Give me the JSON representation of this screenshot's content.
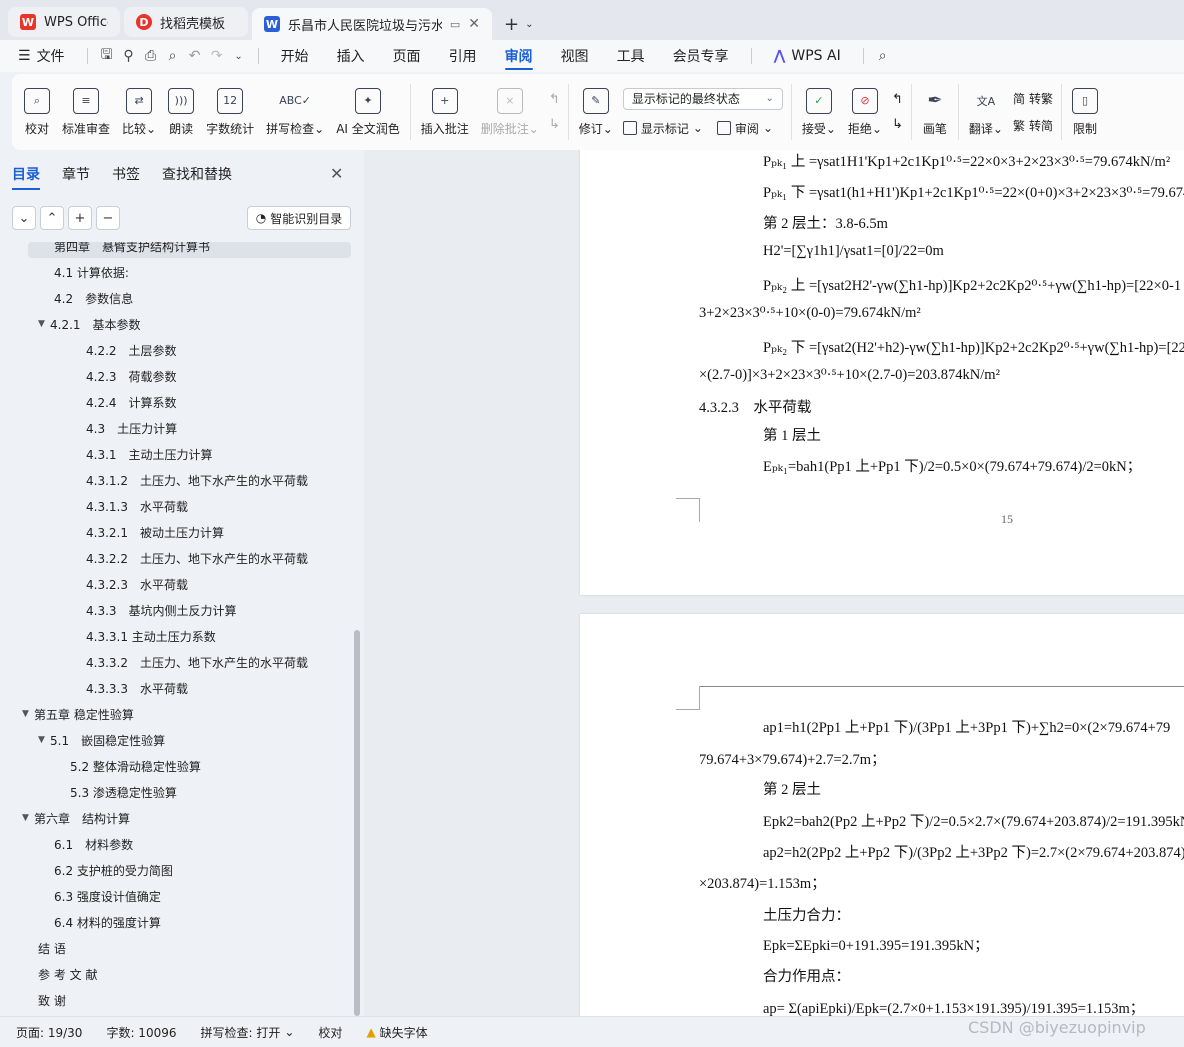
{
  "tabs": [
    {
      "label": "WPS Office",
      "icon": "wps-logo-icon"
    },
    {
      "label": "找稻壳模板",
      "icon": "docer-logo-icon"
    },
    {
      "label": "乐昌市人民医院垃圾与污水处",
      "icon": "word-doc-icon",
      "active": true
    }
  ],
  "menu": {
    "file": "文件",
    "items": [
      "开始",
      "插入",
      "页面",
      "引用",
      "审阅",
      "视图",
      "工具",
      "会员专享"
    ],
    "active": "审阅",
    "ai": "WPS AI"
  },
  "ribbon": {
    "proofread": "校对",
    "std_review": "标准审查",
    "compare": "比较",
    "read_aloud": "朗读",
    "word_count": "字数统计",
    "spell_check": "拼写检查",
    "ai_polish": "AI 全文润色",
    "insert_comment": "插入批注",
    "delete_comment": "删除批注",
    "revise": "修订",
    "markup_state": "显示标记的最终状态",
    "show_markup": "显示标记",
    "review": "审阅",
    "accept": "接受",
    "reject": "拒绝",
    "pen": "画笔",
    "translate": "翻译",
    "to_trad": "转繁",
    "to_simp": "转简",
    "restrict": "限制"
  },
  "sidebar": {
    "tabs": [
      "目录",
      "章节",
      "书签",
      "查找和替换"
    ],
    "active_tab": "目录",
    "smart_toc": "智能识别目录",
    "toc": [
      {
        "text": "第四章　悬臂支护结构计算书",
        "level": 1,
        "highlight": true
      },
      {
        "text": "4.1 计算依据:",
        "level": 2
      },
      {
        "text": "4.2　参数信息",
        "level": 2
      },
      {
        "text": "4.2.1　基本参数",
        "level": 2,
        "expanded": true
      },
      {
        "text": "4.2.2　土层参数",
        "level": 3
      },
      {
        "text": "4.2.3　荷载参数",
        "level": 3
      },
      {
        "text": "4.2.4　计算系数",
        "level": 3
      },
      {
        "text": "4.3　土压力计算",
        "level": 3
      },
      {
        "text": "4.3.1　主动土压力计算",
        "level": 3
      },
      {
        "text": "4.3.1.2　土压力、地下水产生的水平荷载",
        "level": 3
      },
      {
        "text": "4.3.1.3　水平荷载",
        "level": 3
      },
      {
        "text": "4.3.2.1　被动土压力计算",
        "level": 3
      },
      {
        "text": "4.3.2.2　土压力、地下水产生的水平荷载",
        "level": 3
      },
      {
        "text": "4.3.2.3　水平荷载",
        "level": 3
      },
      {
        "text": "4.3.3　基坑内侧土反力计算",
        "level": 3
      },
      {
        "text": "4.3.3.1 主动土压力系数",
        "level": 3
      },
      {
        "text": "4.3.3.2　土压力、地下水产生的水平荷载",
        "level": 3
      },
      {
        "text": "4.3.3.3　水平荷载",
        "level": 3
      },
      {
        "text": "第五章 稳定性验算",
        "level": 1,
        "expanded": true
      },
      {
        "text": "5.1　嵌固稳定性验算",
        "level": 2,
        "expanded": true
      },
      {
        "text": "5.2 整体滑动稳定性验算",
        "level": 25
      },
      {
        "text": "5.3 渗透稳定性验算",
        "level": 25
      },
      {
        "text": "第六章　结构计算",
        "level": 1,
        "expanded": true
      },
      {
        "text": "6.1　材料参数",
        "level": 2
      },
      {
        "text": "6.2 支护桩的受力简图",
        "level": 2
      },
      {
        "text": "6.3 强度设计值确定",
        "level": 2
      },
      {
        "text": "6.4 材料的强度计算",
        "level": 2
      },
      {
        "text": "结 语",
        "level": 0
      },
      {
        "text": "参 考 文 献",
        "level": 0
      },
      {
        "text": "致 谢",
        "level": 0
      }
    ]
  },
  "document": {
    "page1_lines": [
      "Pₚₖ₁ 上 =γsat1H1'Kp1+2c1Kp1⁰·⁵=22×0×3+2×23×3⁰·⁵=79.674kN/m²",
      "Pₚₖ₁ 下 =γsat1(h1+H1')Kp1+2c1Kp1⁰·⁵=22×(0+0)×3+2×23×3⁰·⁵=79.674",
      "第 2 层土：3.8-6.5m",
      "H2'=[∑γ1h1]/γsat1=[0]/22=0m",
      "Pₚₖ₂ 上 =[γsat2H2'-γw(∑h1-hp)]Kp2+2c2Kp2⁰·⁵+γw(∑h1-hp)=[22×0-1",
      "3+2×23×3⁰·⁵+10×(0-0)=79.674kN/m²",
      "Pₚₖ₂ 下 =[γsat2(H2'+h2)-γw(∑h1-hp)]Kp2+2c2Kp2⁰·⁵+γw(∑h1-hp)=[22×",
      "×(2.7-0)]×3+2×23×3⁰·⁵+10×(2.7-0)=203.874kN/m²",
      "4.3.2.3　水平荷载",
      "第 1 层土",
      "Eₚₖ₁=bah1(Pp1 上+Pp1 下)/2=0.5×0×(79.674+79.674)/2=0kN；"
    ],
    "page_number": "15",
    "page2_lines": [
      "ap1=h1(2Pp1 上+Pp1 下)/(3Pp1 上+3Pp1 下)+∑h2=0×(2×79.674+79",
      "79.674+3×79.674)+2.7=2.7m；",
      "第 2 层土",
      "Epk2=bah2(Pp2 上+Pp2 下)/2=0.5×2.7×(79.674+203.874)/2=191.395kN",
      "ap2=h2(2Pp2 上+Pp2 下)/(3Pp2 上+3Pp2 下)=2.7×(2×79.674+203.874)/(3×",
      "×203.874)=1.153m；",
      "土压力合力：",
      "Epk=ΣEpki=0+191.395=191.395kN；",
      "合力作用点：",
      "ap= Σ(apiEpki)/Epk=(2.7×0+1.153×191.395)/191.395=1.153m；"
    ]
  },
  "status": {
    "page": "页面: 19/30",
    "words": "字数: 10096",
    "spell": "拼写检查: 打开",
    "proof": "校对",
    "missing_font": "缺失字体"
  },
  "watermark": "CSDN @biyezuopinvip",
  "colors": {
    "accent": "#1a5fd6",
    "wps_red": "#e8352b",
    "word_blue": "#2b5fd9"
  }
}
